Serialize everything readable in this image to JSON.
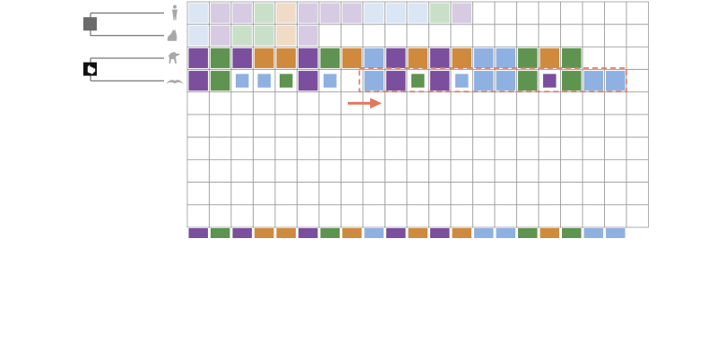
{
  "colors": {
    "purple": "#7b4f9e",
    "green": "#5f9350",
    "orange": "#d08a3e",
    "blue": "#8fb1e1",
    "light_blue": "#dbe6f4",
    "light_purple": "#d7cbe3",
    "light_green": "#c9e0c8",
    "light_orange": "#f0dcc6",
    "highlight": "#e07a5f",
    "grid_line": "#9a9a9a",
    "tree_line": "#555555"
  },
  "taxa": [
    {
      "name": "human",
      "icon": "human-icon"
    },
    {
      "name": "cat",
      "icon": "cat-icon"
    },
    {
      "name": "dog",
      "icon": "dog-icon"
    },
    {
      "name": "bird",
      "icon": "bird-icon"
    }
  ],
  "tree_nodes": [
    {
      "name": "clade-node-upper",
      "icon": "node-square-icon",
      "interactable": false
    },
    {
      "name": "clade-node-lower-pointer",
      "icon": "hand-pointer-icon",
      "interactable": true
    }
  ],
  "grid": {
    "columns": 21,
    "rows": 10,
    "cells": [
      [
        "light_blue",
        "light_purple",
        "light_purple",
        "light_green",
        "light_orange",
        "light_purple",
        "light_purple",
        "light_purple",
        "light_blue",
        "light_blue",
        "light_blue",
        "light_green",
        "light_purple",
        "",
        "",
        "",
        "",
        "",
        "",
        "",
        ""
      ],
      [
        "light_blue",
        "light_purple",
        "light_green",
        "light_green",
        "light_orange",
        "light_purple",
        "",
        "",
        "",
        "",
        "",
        "",
        "",
        "",
        "",
        "",
        "",
        "",
        "",
        "",
        ""
      ],
      [
        "purple",
        "green",
        "purple",
        "orange",
        "orange",
        "purple",
        "green",
        "orange",
        "blue",
        "purple",
        "orange",
        "purple",
        "orange",
        "blue",
        "blue",
        "green",
        "orange",
        "green",
        "",
        "",
        ""
      ],
      [
        "purple",
        "green",
        "blue-small",
        "blue-small",
        "green-small",
        "purple",
        "blue-small",
        "",
        "blue",
        "purple",
        "green-small",
        "purple",
        "blue-small",
        "blue",
        "blue",
        "green",
        "purple-small",
        "green",
        "blue",
        "blue",
        ""
      ]
    ],
    "highlight_row": 3,
    "highlight_col_start": 8,
    "highlight_col_end": 19
  },
  "arrow": {
    "direction": "right"
  },
  "consensus_row": [
    "purple",
    "green",
    "purple",
    "orange",
    "orange",
    "purple",
    "green",
    "orange",
    "blue",
    "purple",
    "orange",
    "purple",
    "orange",
    "blue",
    "blue",
    "green",
    "orange",
    "green",
    "blue",
    "blue"
  ]
}
